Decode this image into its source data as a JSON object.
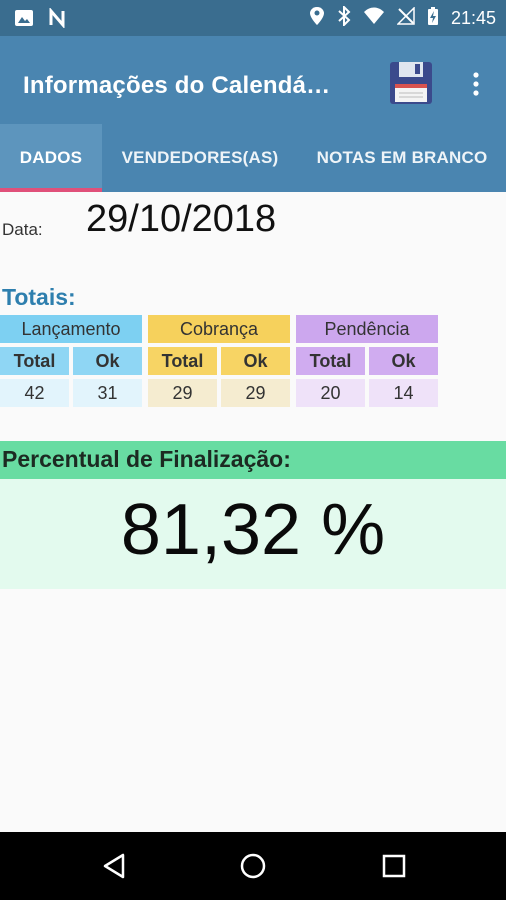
{
  "status_bar": {
    "time": "21:45",
    "left_icons": [
      "image-icon",
      "n-icon"
    ],
    "right_icons": [
      "location-icon",
      "bluetooth-icon",
      "wifi-icon",
      "no-signal-icon",
      "battery-charging-icon"
    ]
  },
  "app_bar": {
    "title": "Informações do Calendá…",
    "save_icon": "floppy-disk-icon",
    "menu_icon": "more-vert-icon"
  },
  "tabs": [
    {
      "label": "DADOS",
      "active": true
    },
    {
      "label": "VENDEDORES(AS)",
      "active": false
    },
    {
      "label": "NOTAS EM BRANCO",
      "active": false
    }
  ],
  "date": {
    "label": "Data:",
    "value": "29/10/2018"
  },
  "totals": {
    "title": "Totais:",
    "groups": [
      {
        "name": "Lançamento",
        "sub_total": "Total",
        "sub_ok": "Ok",
        "total": "42",
        "ok": "31",
        "head_color": "#7dd0f2",
        "sub_color": "#8fd6f4",
        "val_color": "#e2f4fc"
      },
      {
        "name": "Cobrança",
        "sub_total": "Total",
        "sub_ok": "Ok",
        "total": "29",
        "ok": "29",
        "head_color": "#f6d15c",
        "sub_color": "#f7d464",
        "val_color": "#f5ecd0"
      },
      {
        "name": "Pendência",
        "sub_total": "Total",
        "sub_ok": "Ok",
        "total": "20",
        "ok": "14",
        "head_color": "#cca7ee",
        "sub_color": "#d0acf0",
        "val_color": "#efe2f9"
      }
    ]
  },
  "percent": {
    "label": "Percentual de Finalização:",
    "value": "81,32 %"
  },
  "nav": {
    "back_icon": "back-triangle-icon",
    "home_icon": "home-circle-icon",
    "recents_icon": "recents-square-icon"
  }
}
